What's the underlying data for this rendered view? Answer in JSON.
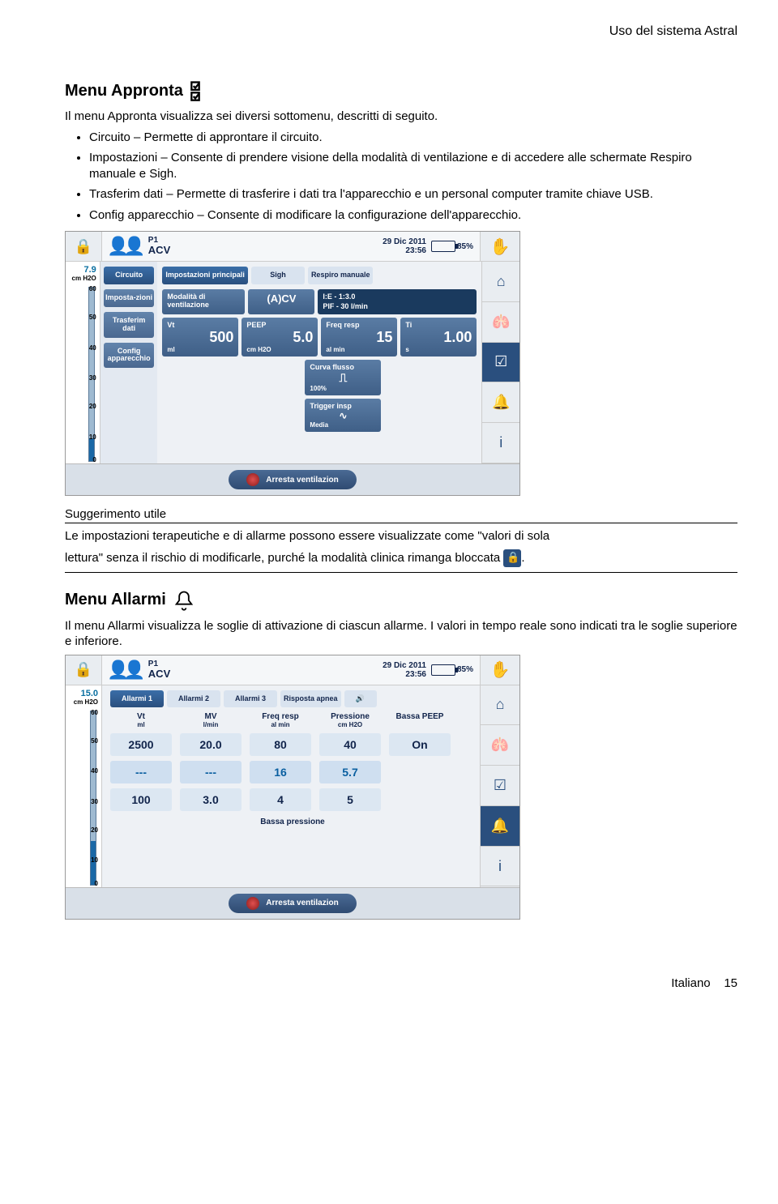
{
  "header": {
    "right": "Uso del sistema Astral"
  },
  "sec1": {
    "title": "Menu Appronta",
    "intro": "Il menu Appronta visualizza sei diversi sottomenu, descritti di seguito.",
    "bullets": [
      "Circuito – Permette di approntare il circuito.",
      "Impostazioni – Consente di prendere visione della modalità di ventilazione e di accedere alle schermate Respiro manuale e Sigh.",
      "Trasferim dati – Permette di trasferire i dati tra l'apparecchio e un personal computer tramite chiave USB.",
      "Config apparecchio – Consente di modificare la configurazione dell'apparecchio."
    ]
  },
  "ss_common": {
    "p_label": "P1",
    "mode": "ACV",
    "date": "29 Dic 2011",
    "time": "23:56",
    "batt": "85%",
    "gauge_unit": "cm H2O",
    "ticks": [
      "60",
      "50",
      "40",
      "30",
      "20",
      "10",
      "0"
    ],
    "stop": "Arresta ventilazion"
  },
  "ss1": {
    "gauge_val": "7.9",
    "left_nav": [
      "Circuito",
      "Imposta-zioni",
      "Trasferim dati",
      "Config apparecchio"
    ],
    "tabs": [
      "Impostazioni principali",
      "Sigh",
      "Respiro manuale"
    ],
    "mode_row": {
      "lbl": "Modalità di ventilazione",
      "val": "(A)CV"
    },
    "info": {
      "ie": "I:E - 1:3.0",
      "pif": "PIF - 30    l/min"
    },
    "params": {
      "vt": {
        "lbl": "Vt",
        "unit": "ml",
        "val": "500"
      },
      "peep": {
        "lbl": "PEEP",
        "unit": "cm H2O",
        "val": "5.0"
      },
      "freq": {
        "lbl": "Freq resp",
        "unit": "al min",
        "val": "15"
      },
      "ti": {
        "lbl": "Ti",
        "unit": "s",
        "val": "1.00"
      },
      "curva": {
        "lbl": "Curva flusso",
        "val": "100%"
      },
      "trigger": {
        "lbl": "Trigger insp",
        "val": "Media"
      }
    }
  },
  "tip": {
    "title": "Suggerimento utile",
    "line1": "Le impostazioni terapeutiche e di allarme possono essere visualizzate come \"valori di sola",
    "line2a": "lettura\" senza il rischio di modificarle, purché la modalità clinica rimanga bloccata ",
    "line2b": "."
  },
  "sec2": {
    "title": "Menu Allarmi",
    "body": "Il menu Allarmi visualizza le soglie di attivazione di ciascun allarme. I valori in tempo reale sono indicati tra le soglie superiore e inferiore."
  },
  "ss2": {
    "gauge_val": "15.0",
    "tabs": [
      "Allarmi 1",
      "Allarmi 2",
      "Allarmi 3",
      "Risposta apnea"
    ],
    "cols": [
      {
        "h": "Vt",
        "u": "ml"
      },
      {
        "h": "MV",
        "u": "l/min"
      },
      {
        "h": "Freq resp",
        "u": "al min"
      },
      {
        "h": "Pressione",
        "u": "cm H2O"
      },
      {
        "h": "Bassa PEEP",
        "u": ""
      }
    ],
    "rows": [
      [
        "2500",
        "20.0",
        "80",
        "40",
        "On"
      ],
      [
        "---",
        "---",
        "16",
        "5.7",
        ""
      ],
      [
        "100",
        "3.0",
        "4",
        "5",
        ""
      ]
    ],
    "bassa": "Bassa pressione"
  },
  "footer": {
    "lang": "Italiano",
    "page": "15"
  }
}
